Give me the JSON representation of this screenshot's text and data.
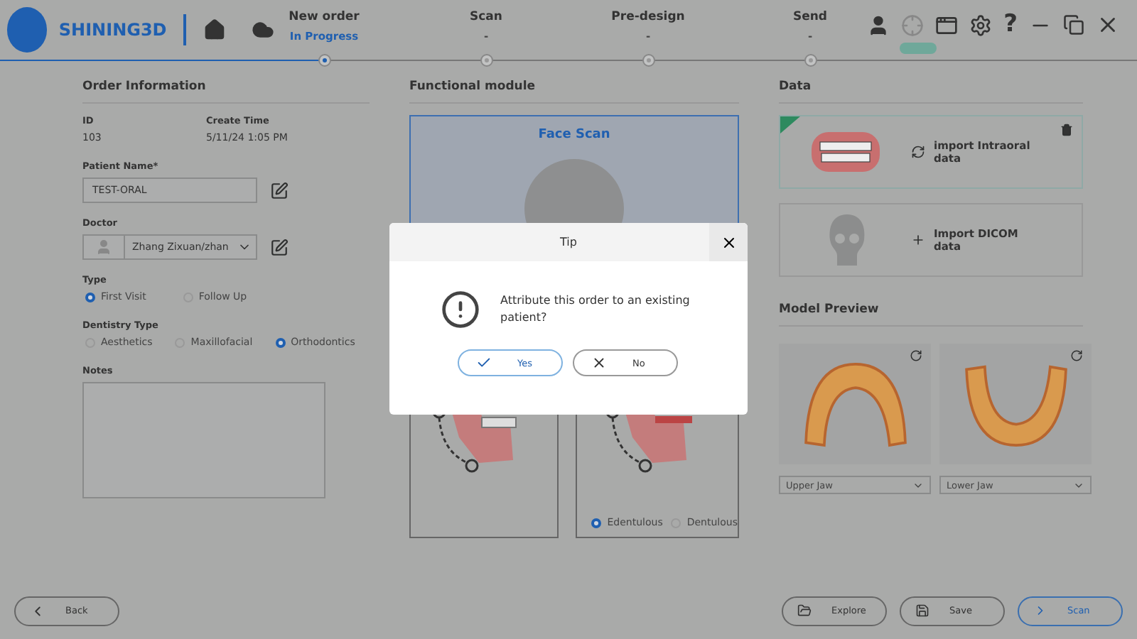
{
  "header": {
    "logo": "SHINING3D",
    "help": "?"
  },
  "steps": [
    {
      "label": "New order",
      "status": "In Progress",
      "selected": true
    },
    {
      "label": "Scan",
      "status": "-",
      "selected": false
    },
    {
      "label": "Pre-design",
      "status": "-",
      "selected": false
    },
    {
      "label": "Send",
      "status": "-",
      "selected": false
    }
  ],
  "order_information": {
    "title": "Order Information",
    "id_label": "ID",
    "id": "103",
    "create_time_label": "Create Time",
    "create_time": "5/11/24 1:05 PM",
    "patient_name_label": "Patient Name*",
    "patient_name": "TEST-ORAL",
    "doctor_label": "Doctor",
    "doctor": "Zhang Zixuan/zhan",
    "type_label": "Type",
    "types": [
      {
        "label": "First Visit",
        "selected": true
      },
      {
        "label": "Follow Up",
        "selected": false
      }
    ],
    "dentistry_type_label": "Dentistry Type",
    "dentistry_types": [
      {
        "label": "Aesthetics",
        "selected": false
      },
      {
        "label": "Maxillofacial",
        "selected": false
      },
      {
        "label": "Orthodontics",
        "selected": true
      }
    ],
    "notes_label": "Notes"
  },
  "functional_module": {
    "title": "Functional module",
    "face_scan": "Face Scan",
    "jaw_options": [
      {
        "label": "Edentulous",
        "selected": true
      },
      {
        "label": "Dentulous",
        "selected": false
      }
    ]
  },
  "data": {
    "title": "Data",
    "items": [
      {
        "kind": "intraoral",
        "label": "import Intraoral data",
        "imported": true
      },
      {
        "kind": "dicom",
        "label": "Import DICOM data",
        "imported": false
      }
    ]
  },
  "model_preview": {
    "title": "Model Preview",
    "models": [
      {
        "kind": "upper",
        "jaw": "Upper Jaw"
      },
      {
        "kind": "lower",
        "jaw": "Lower Jaw"
      }
    ]
  },
  "footer": {
    "back": "Back",
    "buttons": [
      {
        "kind": "explore",
        "label": "Explore",
        "primary": false
      },
      {
        "kind": "save",
        "label": "Save",
        "primary": false
      },
      {
        "kind": "scan",
        "label": "Scan",
        "primary": true
      }
    ]
  },
  "dialog": {
    "title": "Tip",
    "message": "Attribute this order to an existing patient?",
    "buttons": [
      {
        "kind": "yes",
        "label": "Yes"
      },
      {
        "kind": "no",
        "label": "No"
      }
    ]
  }
}
